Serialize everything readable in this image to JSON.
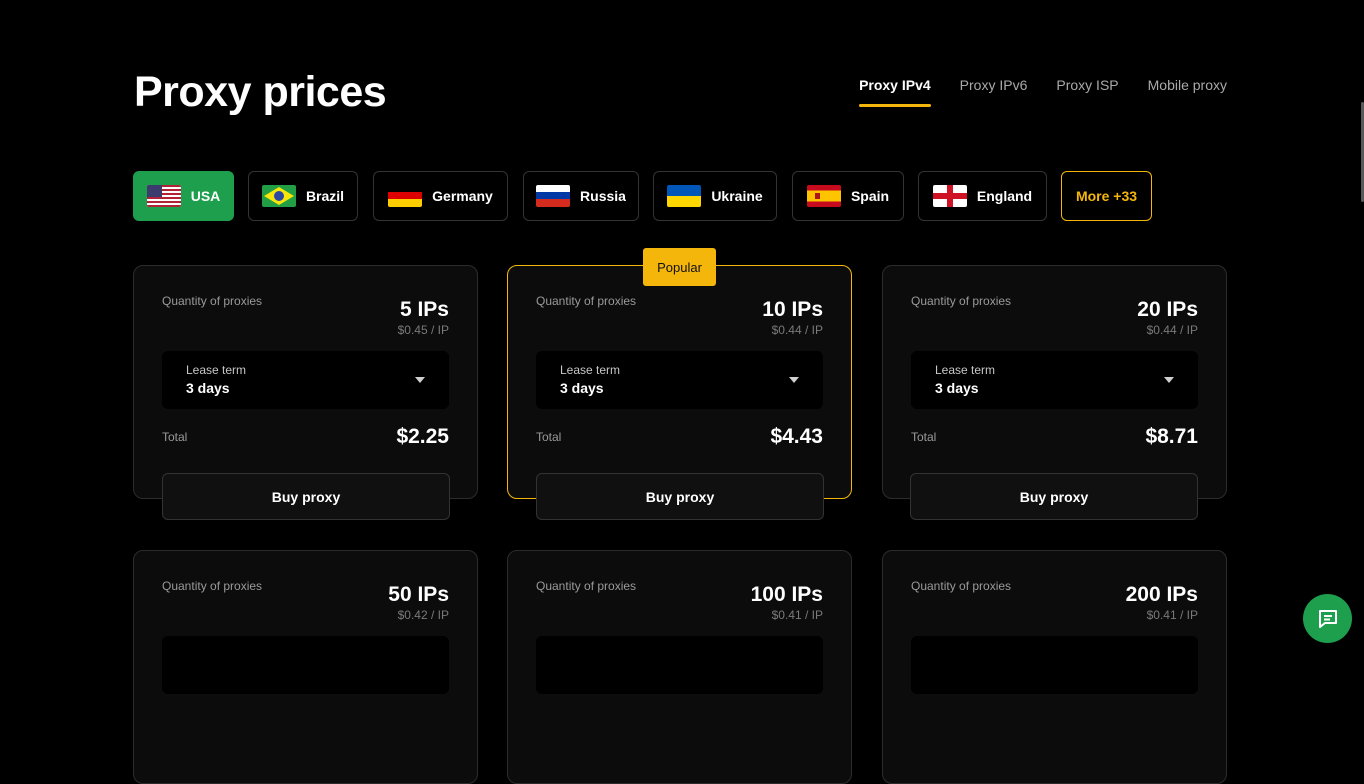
{
  "page": {
    "title": "Proxy prices"
  },
  "tabs": [
    "Proxy IPv4",
    "Proxy IPv6",
    "Proxy ISP",
    "Mobile proxy"
  ],
  "active_tab": "Proxy IPv4",
  "countries": [
    {
      "name": "USA",
      "flag": "usa-flag-icon",
      "active": true
    },
    {
      "name": "Brazil",
      "flag": "brazil-flag-icon"
    },
    {
      "name": "Germany",
      "flag": "germany-flag-icon"
    },
    {
      "name": "Russia",
      "flag": "russia-flag-icon"
    },
    {
      "name": "Ukraine",
      "flag": "ukraine-flag-icon"
    },
    {
      "name": "Spain",
      "flag": "spain-flag-icon"
    },
    {
      "name": "England",
      "flag": "england-flag-icon"
    },
    {
      "name": "More +33"
    }
  ],
  "plans": [
    {
      "quantity_label": "Quantity of proxies",
      "ips": "5 IPs",
      "per_ip": "$0.45 / IP",
      "lease_label": "Lease term",
      "lease_value": "3 days",
      "total_label": "Total",
      "total": "$2.25",
      "buy_label": "Buy proxy"
    },
    {
      "quantity_label": "Quantity of proxies",
      "ips": "10 IPs",
      "per_ip": "$0.44 / IP",
      "lease_label": "Lease term",
      "lease_value": "3 days",
      "total_label": "Total",
      "total": "$4.43",
      "buy_label": "Buy proxy",
      "badge": "Popular"
    },
    {
      "quantity_label": "Quantity of proxies",
      "ips": "20 IPs",
      "per_ip": "$0.44 / IP",
      "lease_label": "Lease term",
      "lease_value": "3 days",
      "total_label": "Total",
      "total": "$8.71",
      "buy_label": "Buy proxy"
    },
    {
      "quantity_label": "Quantity of proxies",
      "ips": "50 IPs",
      "per_ip": "$0.42 / IP"
    },
    {
      "quantity_label": "Quantity of proxies",
      "ips": "100 IPs",
      "per_ip": "$0.41 / IP"
    },
    {
      "quantity_label": "Quantity of proxies",
      "ips": "200 IPs",
      "per_ip": "$0.41 / IP"
    }
  ],
  "colors": {
    "accent": "#f5b60c",
    "active_country": "#1d9f4d",
    "background": "#000000",
    "card": "#0c0c0c"
  },
  "chat": {
    "icon": "chat-icon"
  }
}
